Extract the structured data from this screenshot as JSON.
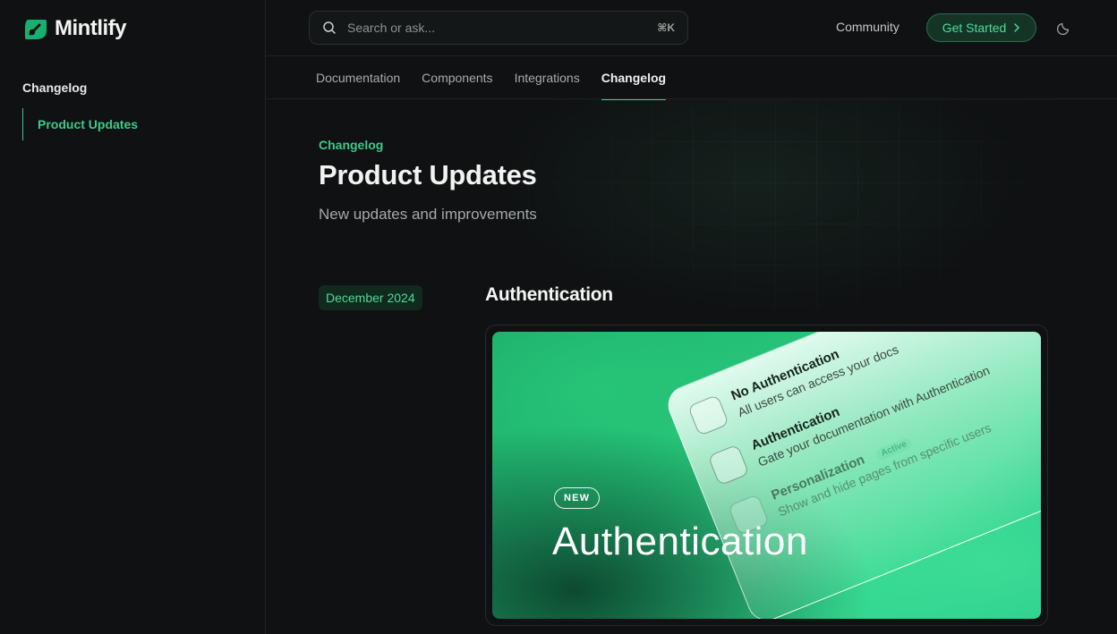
{
  "brand": {
    "name": "Mintlify",
    "accent": "#3ec98a"
  },
  "sidebar": {
    "heading": "Changelog",
    "items": [
      {
        "label": "Product Updates",
        "active": true
      }
    ]
  },
  "header": {
    "search": {
      "placeholder": "Search or ask...",
      "shortcut": "⌘K"
    },
    "community_label": "Community",
    "cta_label": "Get Started",
    "theme_icon": "moon-icon"
  },
  "tabs": [
    {
      "label": "Documentation"
    },
    {
      "label": "Components"
    },
    {
      "label": "Integrations"
    },
    {
      "label": "Changelog",
      "active": true
    }
  ],
  "main": {
    "eyebrow": "Changelog",
    "title": "Product Updates",
    "subtitle": "New updates and improvements",
    "entry": {
      "date": "December 2024",
      "title": "Authentication",
      "image": {
        "badge": "NEW",
        "title": "Authentication",
        "options": [
          {
            "title": "No Authentication",
            "desc": "All users can access your docs",
            "icon": "unlock-icon"
          },
          {
            "title": "Authentication",
            "desc": "Gate your documentation with Authentication",
            "icon": "user-key-icon"
          },
          {
            "title": "Personalization",
            "desc": "Show and hide pages from specific users",
            "status": "Active",
            "icon": "eye-icon"
          }
        ]
      }
    }
  }
}
